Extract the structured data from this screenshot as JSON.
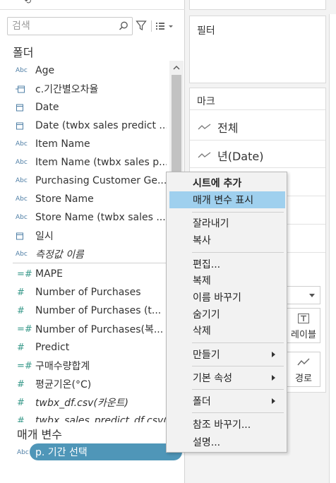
{
  "search": {
    "placeholder": "검색"
  },
  "data_pane": {
    "folder_title": "폴더",
    "params_title": "매개 변수",
    "fields": [
      {
        "icon": "abc",
        "label": "Age",
        "italic": false
      },
      {
        "icon": "calendar-abc",
        "label": "c.기간별오차율",
        "italic": false
      },
      {
        "icon": "calendar",
        "label": "Date",
        "italic": false
      },
      {
        "icon": "calendar",
        "label": "Date (twbx sales predict ...",
        "italic": false
      },
      {
        "icon": "abc",
        "label": "Item Name",
        "italic": false
      },
      {
        "icon": "abc",
        "label": "Item Name (twbx sales p...",
        "italic": false
      },
      {
        "icon": "abc",
        "label": "Purchasing Customer Ge...",
        "italic": false
      },
      {
        "icon": "abc",
        "label": "Store Name",
        "italic": false
      },
      {
        "icon": "abc",
        "label": "Store Name (twbx sales ...",
        "italic": false
      },
      {
        "icon": "calendar",
        "label": "일시",
        "italic": false
      },
      {
        "icon": "abc",
        "label": "측정값 이름",
        "italic": true
      },
      {
        "icon": "measure-calc",
        "label": "MAPE",
        "italic": false
      },
      {
        "icon": "measure",
        "label": "Number of Purchases",
        "italic": false
      },
      {
        "icon": "measure",
        "label": "Number of Purchases (t...",
        "italic": false
      },
      {
        "icon": "measure-calc",
        "label": "Number of Purchases(복...",
        "italic": false
      },
      {
        "icon": "measure",
        "label": "Predict",
        "italic": false
      },
      {
        "icon": "measure-calc",
        "label": "구매수량합계",
        "italic": false
      },
      {
        "icon": "measure",
        "label": "평균기온(°C)",
        "italic": false
      },
      {
        "icon": "measure",
        "label": "twbx_df.csv(카운트)",
        "italic": true
      },
      {
        "icon": "measure",
        "label": "twbx_sales_predict_df.csv(",
        "italic": true
      }
    ],
    "parameter": {
      "icon": "abc",
      "label": "p. 기간 선택"
    }
  },
  "shelf": {
    "filters_title": "필터",
    "marks_title": "마크",
    "marks_all": "전체",
    "marks_year": "년(Date)",
    "label_button": "레이블",
    "path_button": "경로"
  },
  "context_menu": {
    "items": [
      {
        "label": "시트에 추가",
        "bold": true,
        "highlight": false,
        "submenu": false
      },
      {
        "label": "매개 변수 표시",
        "bold": false,
        "highlight": true,
        "submenu": false
      },
      {
        "label": "잘라내기",
        "bold": false,
        "highlight": false,
        "submenu": false
      },
      {
        "label": "복사",
        "bold": false,
        "highlight": false,
        "submenu": false
      },
      {
        "label": "편집...",
        "bold": false,
        "highlight": false,
        "submenu": false
      },
      {
        "label": "복제",
        "bold": false,
        "highlight": false,
        "submenu": false
      },
      {
        "label": "이름 바꾸기",
        "bold": false,
        "highlight": false,
        "submenu": false
      },
      {
        "label": "숨기기",
        "bold": false,
        "highlight": false,
        "submenu": false
      },
      {
        "label": "삭제",
        "bold": false,
        "highlight": false,
        "submenu": false
      },
      {
        "label": "만들기",
        "bold": false,
        "highlight": false,
        "submenu": true
      },
      {
        "label": "기본 속성",
        "bold": false,
        "highlight": false,
        "submenu": true
      },
      {
        "label": "폴더",
        "bold": false,
        "highlight": false,
        "submenu": true
      },
      {
        "label": "참조 바꾸기...",
        "bold": false,
        "highlight": false,
        "submenu": false
      },
      {
        "label": "설명...",
        "bold": false,
        "highlight": false,
        "submenu": false
      }
    ]
  },
  "colors": {
    "dimension_icon": "#4f7fa6",
    "measure_icon": "#3a9a8b",
    "highlight": "#9fd0ee",
    "parameter_pill": "#4f96b8"
  }
}
